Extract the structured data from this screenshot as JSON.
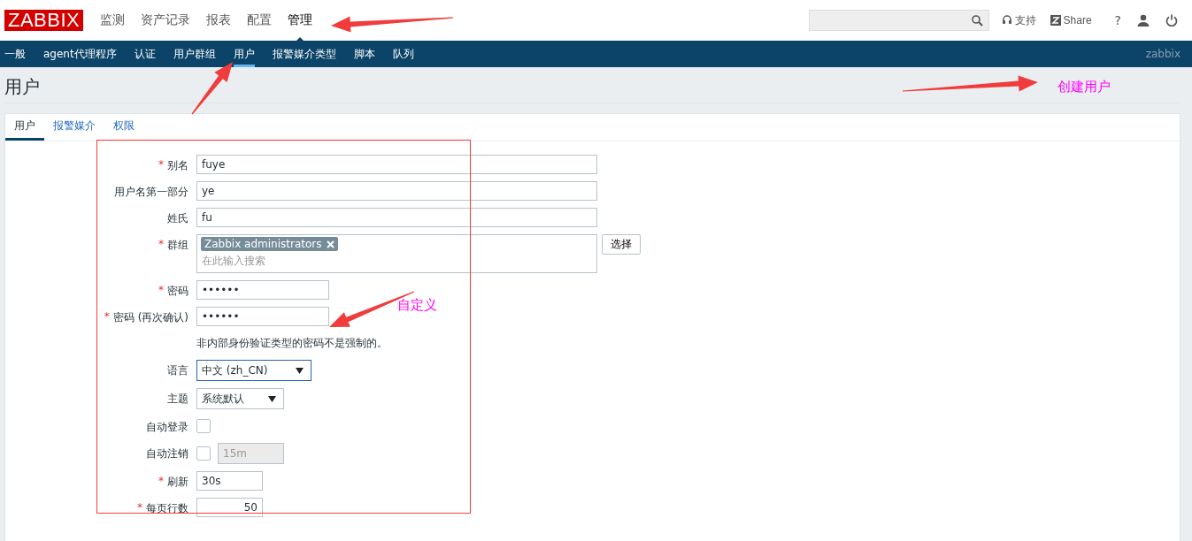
{
  "logo": "ZABBIX",
  "main_menu": [
    {
      "label": "监测",
      "selected": false
    },
    {
      "label": "资产记录",
      "selected": false
    },
    {
      "label": "报表",
      "selected": false
    },
    {
      "label": "配置",
      "selected": false
    },
    {
      "label": "管理",
      "selected": true
    }
  ],
  "header_links": [
    {
      "label": "支持",
      "kind": "support"
    },
    {
      "label": "Share",
      "kind": "share"
    }
  ],
  "help": "?",
  "sub_menu": [
    {
      "label": "一般",
      "selected": false
    },
    {
      "label": "agent代理程序",
      "selected": false
    },
    {
      "label": "认证",
      "selected": false
    },
    {
      "label": "用户群组",
      "selected": false
    },
    {
      "label": "用户",
      "selected": true
    },
    {
      "label": "报警媒介类型",
      "selected": false
    },
    {
      "label": "脚本",
      "selected": false
    },
    {
      "label": "队列",
      "selected": false
    }
  ],
  "user_name": "zabbix",
  "page_title": "用户",
  "tabs": [
    {
      "label": "用户",
      "selected": true
    },
    {
      "label": "报警媒介",
      "selected": false
    },
    {
      "label": "权限",
      "selected": false
    }
  ],
  "form": {
    "rows": [
      {
        "kind": "text",
        "label": "别名",
        "mark": "*",
        "value": "fuye"
      },
      {
        "kind": "text",
        "label": "用户名第一部分",
        "value": "ye"
      },
      {
        "kind": "text",
        "label": "姓氏",
        "value": "fu"
      },
      {
        "kind": "multiselect",
        "label": "群组",
        "mark": "*",
        "tags": [
          "Zabbix administrators"
        ],
        "placeholder": "在此输入搜索",
        "button": "选择"
      },
      {
        "kind": "password",
        "label": "密码",
        "mark": "*",
        "value": "••••••"
      },
      {
        "kind": "password",
        "label": "密码 (再次确认)",
        "mark": "*",
        "value": "••••••"
      },
      {
        "kind": "note",
        "text": "非内部身份验证类型的密码不是强制的。"
      },
      {
        "kind": "select",
        "label": "语言",
        "value": "中文 (zh_CN)",
        "focused": true
      },
      {
        "kind": "select",
        "label": "主题",
        "value": "系统默认",
        "focused": false
      },
      {
        "kind": "checkbox",
        "label": "自动登录",
        "checked": false
      },
      {
        "kind": "checkbox",
        "label": "自动注销",
        "checked": false,
        "field": {
          "value": "15m",
          "disabled": true
        }
      },
      {
        "kind": "short",
        "label": "刷新",
        "mark": "*",
        "value": "30s"
      },
      {
        "kind": "number",
        "label": "每页行数",
        "mark": "*",
        "value": "50"
      }
    ]
  },
  "annotations": [
    {
      "text": "创建用户",
      "kind": "page"
    },
    {
      "text": "自定义",
      "kind": "password"
    }
  ]
}
